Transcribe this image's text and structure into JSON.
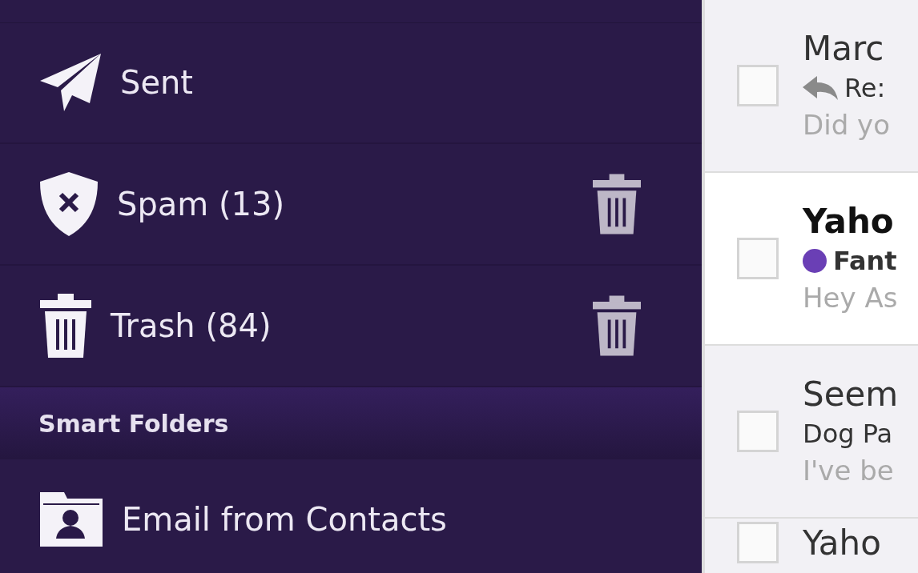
{
  "sidebar": {
    "items": [
      {
        "kind": "sent",
        "label": "Sent",
        "empty_action": false
      },
      {
        "kind": "spam",
        "label": "Spam (13)",
        "empty_action": true
      },
      {
        "kind": "trash",
        "label": "Trash (84)",
        "empty_action": true
      },
      {
        "kind": "header",
        "label": "Smart Folders"
      },
      {
        "kind": "contacts",
        "label": "Email from Contacts",
        "empty_action": false
      }
    ]
  },
  "messages": [
    {
      "sender": "Marc",
      "subject": "Re:",
      "preview": "Did yo",
      "unread": false,
      "checked": false,
      "replied": true
    },
    {
      "sender": "Yaho",
      "subject": "Fant",
      "preview": "Hey As",
      "unread": true,
      "checked": false,
      "replied": false,
      "color": "#6a3fb5"
    },
    {
      "sender": "Seem",
      "subject": "Dog Pa",
      "preview": "I've be",
      "unread": false,
      "checked": false,
      "replied": false
    },
    {
      "sender": "Yaho",
      "unread": false,
      "checked": false
    }
  ]
}
